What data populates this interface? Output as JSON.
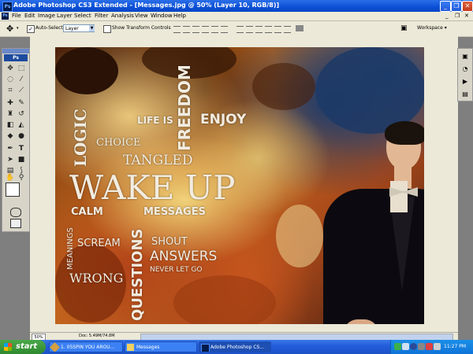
{
  "window": {
    "title": "Adobe Photoshop CS3 Extended - [Messages.jpg @ 50% (Layer 10, RGB/8)]",
    "app_icon": "Ps",
    "controls": {
      "minimize": "_",
      "restore": "❐",
      "close": "✕"
    }
  },
  "menu": {
    "items": [
      "File",
      "Edit",
      "Image",
      "Layer",
      "Select",
      "Filter",
      "Analysis",
      "View",
      "Window",
      "Help"
    ],
    "doc_controls": {
      "minimize": "_",
      "restore": "❐",
      "close": "✕"
    }
  },
  "options": {
    "auto_select_label": "Auto-Select:",
    "auto_select_checked": true,
    "auto_select_value": "Layer",
    "transform_controls_label": "Show Transform Controls",
    "workspace_label": "Workspace ▾"
  },
  "toolbox": {
    "header": "Ps",
    "icons": [
      "move-icon",
      "marquee-icon",
      "lasso-icon",
      "magic-wand-icon",
      "crop-icon",
      "slice-icon",
      "healing-icon",
      "brush-icon",
      "stamp-icon",
      "history-brush-icon",
      "eraser-icon",
      "gradient-icon",
      "blur-icon",
      "dodge-icon",
      "pen-icon",
      "type-icon",
      "path-select-icon",
      "shape-icon",
      "notes-icon",
      "eyedropper-icon",
      "hand-icon",
      "zoom-icon"
    ]
  },
  "canvas_words": {
    "logic": "LOGIC",
    "life_is": "LIFE IS",
    "freedom": "FREEDOM",
    "enjoy": "ENJOY",
    "choice": "CHOICE",
    "tangled": "TANGLED",
    "wake_up": "WAKE UP",
    "calm": "CALM",
    "messages": "MESSAGES",
    "meanings": "MEANINGS",
    "scream": "SCREAM",
    "questions": "QUESTIONS",
    "shout": "SHOUT",
    "answers": "ANSWERS",
    "never_let_go": "NEVER LET GO",
    "wrong": "WRONG"
  },
  "status": {
    "zoom": "50%",
    "doc_info": "Doc: 5.49M/74.8M"
  },
  "taskbar": {
    "start_label": "start",
    "buttons": [
      {
        "label": "1. 05SPIN YOU AROU...",
        "active": false
      },
      {
        "label": "Messages",
        "active": false
      },
      {
        "label": "Adobe Photoshop CS...",
        "active": true
      }
    ],
    "clock": "11:27 PM"
  }
}
